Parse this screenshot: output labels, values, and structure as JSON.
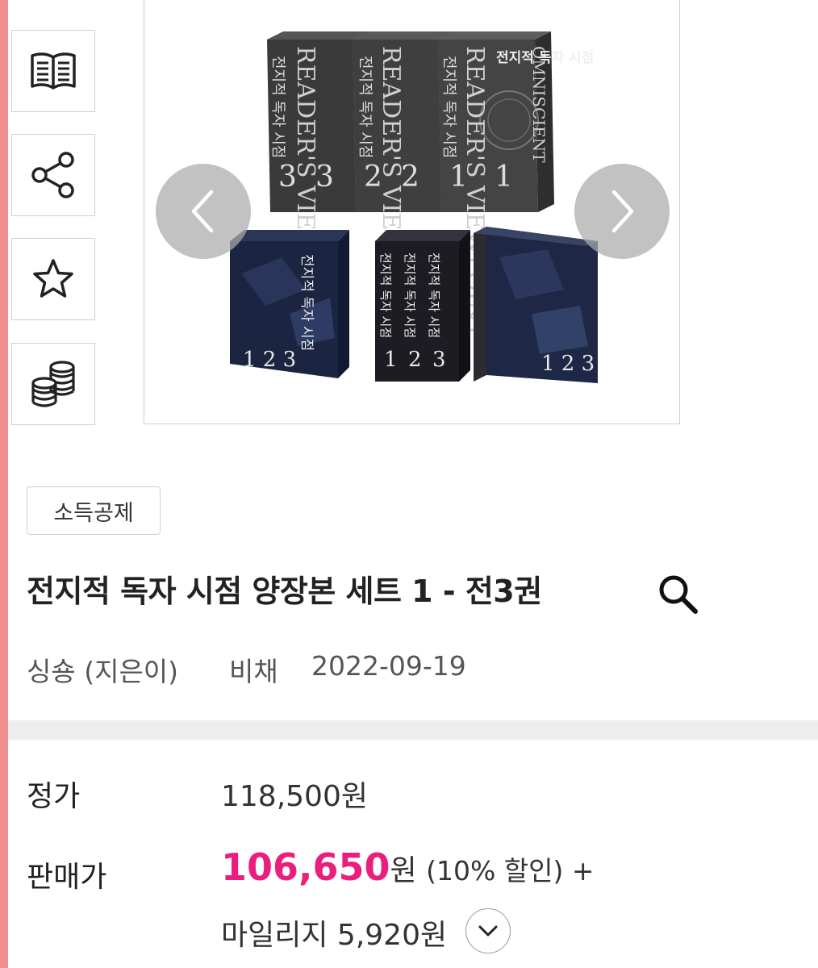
{
  "side_actions": [
    {
      "icon": "book-preview-icon"
    },
    {
      "icon": "share-icon"
    },
    {
      "icon": "star-icon"
    },
    {
      "icon": "coins-icon"
    }
  ],
  "gallery": {
    "prev_icon": "chevron-left-icon",
    "next_icon": "chevron-right-icon",
    "image": {
      "spines": [
        "READER'S VIEWPOINT",
        "OMNISCIENT"
      ],
      "cover_title": "전지적 독자 시점",
      "volumes": [
        "1",
        "2",
        "3"
      ],
      "box_numbers": "1 2 3"
    }
  },
  "product": {
    "badge": "소득공제",
    "title": "전지적 독자 시점 양장본 세트 1 - 전3권",
    "author": "싱숑 (지은이)",
    "publisher": "비채",
    "date": "2022-09-19"
  },
  "pricing": {
    "list_label": "정가",
    "list_price": "118,500원",
    "sale_label": "판매가",
    "sale_amount": "106,650",
    "sale_unit": "원",
    "discount_text": "(10% 할인) +",
    "mileage_text": "마일리지 5,920원"
  },
  "colors": {
    "accent_pink": "#ea1f7d",
    "edge_bar": "#ef8f8f",
    "border": "#cfcfcf"
  }
}
